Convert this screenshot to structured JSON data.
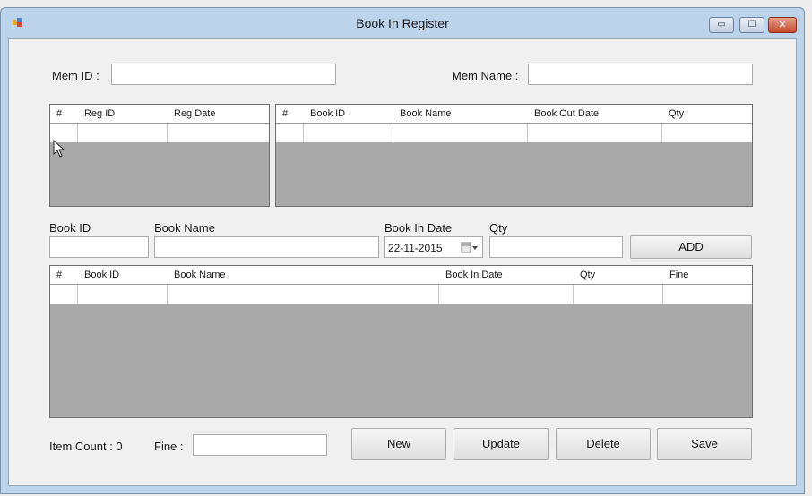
{
  "window": {
    "title": "Book In Register"
  },
  "titlebar_buttons": {
    "minimize": "▭",
    "maximize": "☐",
    "close": "✕"
  },
  "member": {
    "id_label": "Mem ID :",
    "id_value": "",
    "name_label": "Mem Name :",
    "name_value": ""
  },
  "reg_grid": {
    "columns": [
      "#",
      "Reg ID",
      "Reg Date"
    ]
  },
  "out_grid": {
    "columns": [
      "#",
      "Book ID",
      "Book Name",
      "Book Out Date",
      "Qty"
    ]
  },
  "entry": {
    "book_id_label": "Book ID",
    "book_name_label": "Book Name",
    "book_in_date_label": "Book In Date",
    "qty_label": "Qty",
    "book_in_date_value": "22-11-2015",
    "add_label": "ADD"
  },
  "in_grid": {
    "columns": [
      "#",
      "Book ID",
      "Book Name",
      "Book In Date",
      "Qty",
      "Fine"
    ]
  },
  "footer": {
    "item_count": "Item Count : 0",
    "fine_label": "Fine :",
    "new_label": "New",
    "update_label": "Update",
    "delete_label": "Delete",
    "save_label": "Save"
  },
  "icons": {
    "app": "app-icon",
    "calendar": "calendar-icon",
    "cursor": "cursor-pointer"
  }
}
